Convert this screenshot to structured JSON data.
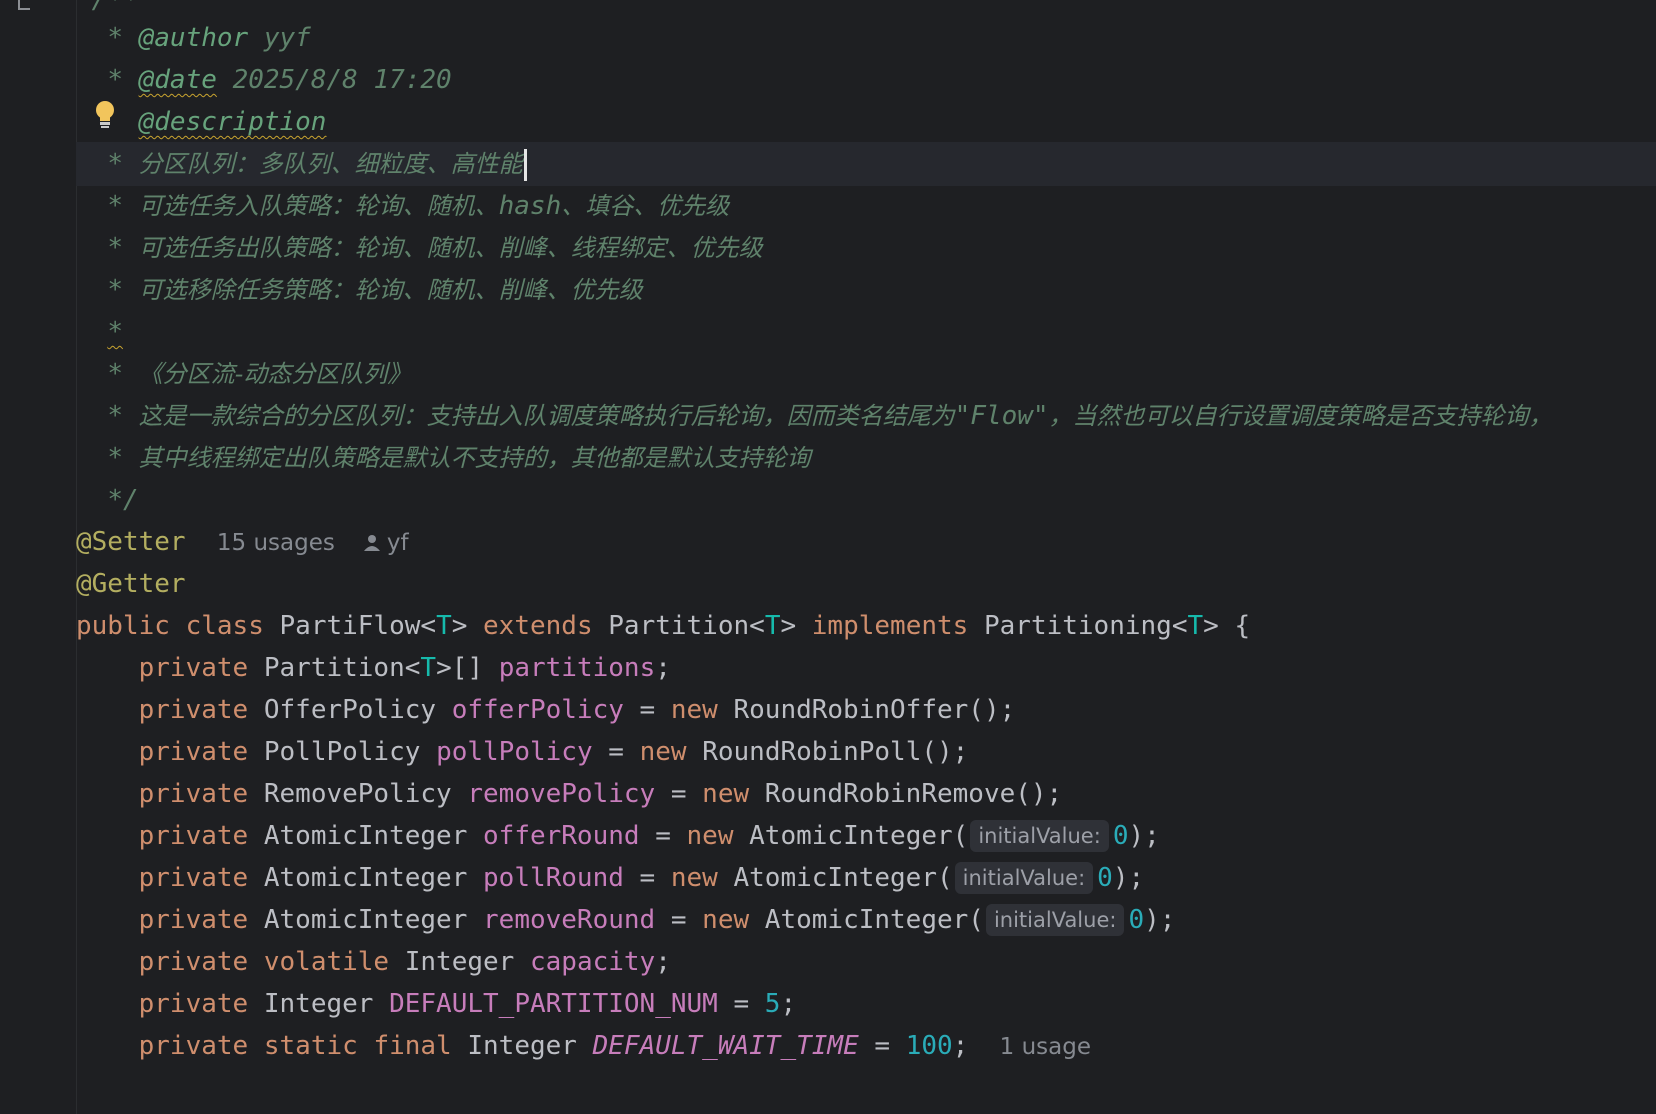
{
  "doc": {
    "top_fragment": "/**",
    "author_tag": "@author",
    "author_value": "yyf",
    "date_tag": "@date",
    "date_value": "2025/8/8 17:20",
    "description_tag": "@description",
    "desc_line1": "分区队列：多队列、细粒度、高性能",
    "desc_line2_pre": "可选任务入队策略：轮询、随机、",
    "desc_line2_hash": "hash",
    "desc_line2_post": "、填谷、优先级",
    "desc_line3": "可选任务出队策略：轮询、随机、削峰、线程绑定、优先级",
    "desc_line4": "可选移除任务策略：轮询、随机、削峰、优先级",
    "star": "*",
    "desc_line6": "《分区流-动态分区队列》",
    "desc_line7_pre": "这是一款综合的分区队列：支持出入队调度策略执行后轮询，因而类名结尾为",
    "desc_line7_flow": "\"Flow\"",
    "desc_line7_post": "，当然也可以自行设置调度策略是否支持轮询，",
    "desc_line8": "其中线程绑定出队策略是默认不支持的，其他都是默认支持轮询",
    "end": "*/"
  },
  "annotations": {
    "setter": "@Setter",
    "setter_usages": "15 usages",
    "setter_author": "yf",
    "getter": "@Getter"
  },
  "class_decl": {
    "public": "public",
    "class": "class",
    "name": "PartiFlow",
    "extends": "extends",
    "parent": "Partition",
    "implements": "implements",
    "iface": "Partitioning",
    "type_param": "T"
  },
  "fields": {
    "private": "private",
    "new": "new",
    "partitions_type": "Partition",
    "partitions_name": "partitions",
    "offer_type": "OfferPolicy",
    "offer_name": "offerPolicy",
    "offer_ctor": "RoundRobinOffer",
    "poll_type": "PollPolicy",
    "poll_name": "pollPolicy",
    "poll_ctor": "RoundRobinPoll",
    "remove_type": "RemovePolicy",
    "remove_name": "removePolicy",
    "remove_ctor": "RoundRobinRemove",
    "atomic_type": "AtomicInteger",
    "offer_round": "offerRound",
    "poll_round": "pollRound",
    "remove_round": "removeRound",
    "hint_label": "initialValue:",
    "zero": "0",
    "volatile": "volatile",
    "integer_type": "Integer",
    "capacity": "capacity",
    "default_partition_num": "DEFAULT_PARTITION_NUM",
    "five": "5",
    "static": "static",
    "final": "final",
    "default_wait_time": "DEFAULT_WAIT_TIME",
    "hundred": "100",
    "wait_usages": "1 usage"
  },
  "colors": {
    "background": "#1e1f22",
    "keyword": "#cf8e6d",
    "field": "#c77dbb",
    "number": "#2aacb8",
    "comment": "#5f826b",
    "annotation": "#b3ae60"
  }
}
